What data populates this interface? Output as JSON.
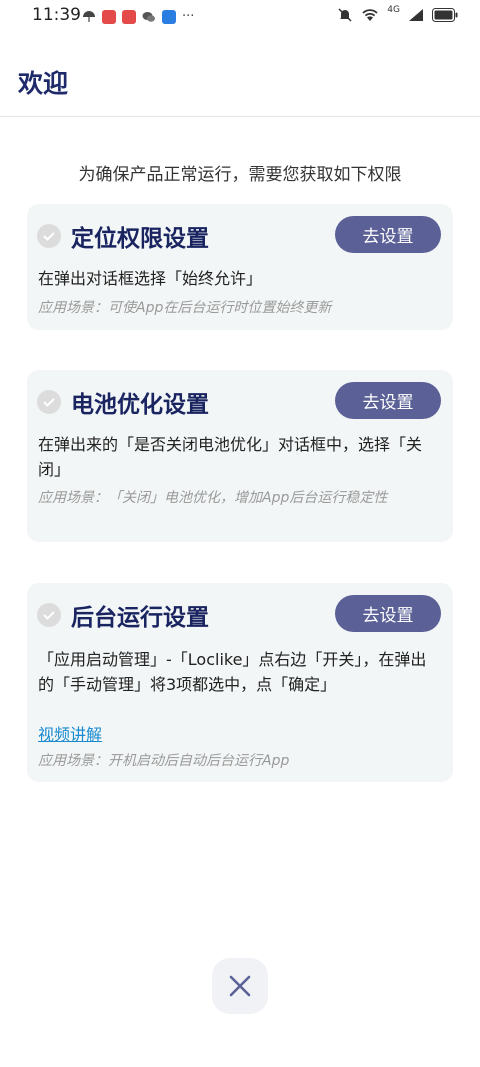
{
  "status_bar": {
    "time": "11:39",
    "more": "···",
    "network": "4G"
  },
  "header": {
    "title": "欢迎"
  },
  "intro": "为确保产品正常运行，需要您获取如下权限",
  "cards": [
    {
      "title": "定位权限设置",
      "button": "去设置",
      "description": "在弹出对话框选择「始终允许」",
      "scene": "应用场景：可使App在后台运行时位置始终更新"
    },
    {
      "title": "电池优化设置",
      "button": "去设置",
      "description": "在弹出来的「是否关闭电池优化」对话框中，选择「关闭」",
      "scene": "应用场景：「关闭」电池优化，增加App后台运行稳定性"
    },
    {
      "title": "后台运行设置",
      "button": "去设置",
      "description": "「应用启动管理」-「Loclike」点右边「开关」，在弹出的「手动管理」将3项都选中，点「确定」",
      "link": "视频讲解",
      "scene": "应用场景：开机启动后自动后台运行App"
    }
  ],
  "colors": {
    "title": "#1f2a6b",
    "button_bg": "#5b6196",
    "card_bg": "#f3f6f6",
    "link": "#1a8bd0"
  }
}
